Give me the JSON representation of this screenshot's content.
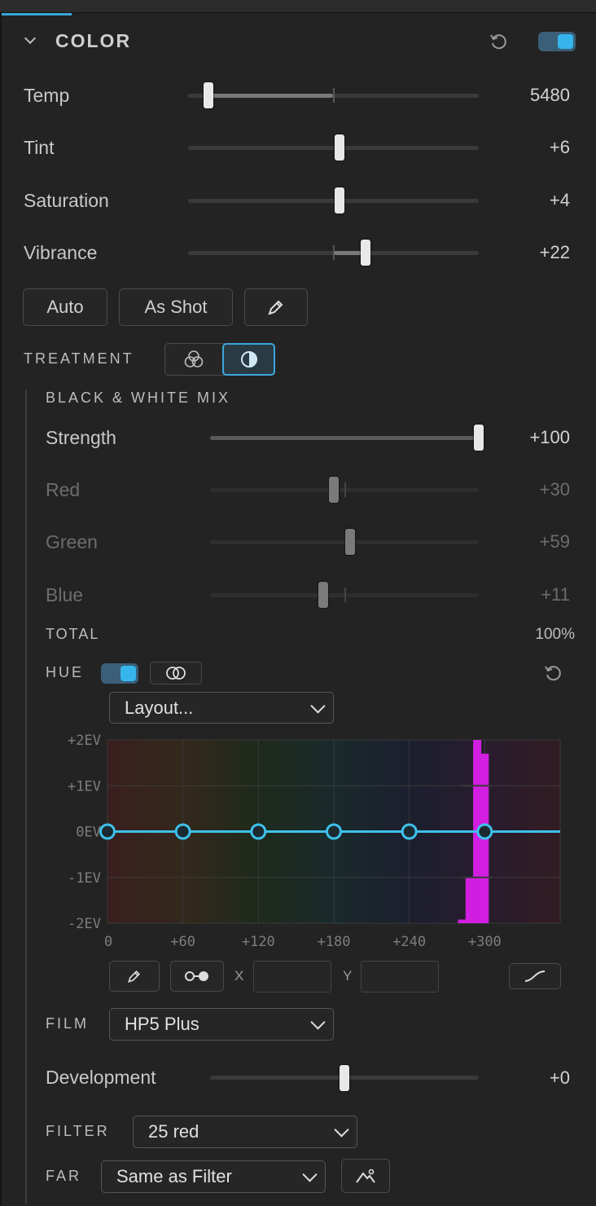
{
  "color_section": {
    "title": "COLOR",
    "sliders": [
      {
        "label": "Temp",
        "value": "5480",
        "position": 0.07
      },
      {
        "label": "Tint",
        "value": "+6",
        "position": 0.52
      },
      {
        "label": "Saturation",
        "value": "+4",
        "position": 0.52
      },
      {
        "label": "Vibrance",
        "value": "+22",
        "position": 0.61
      }
    ],
    "buttons": {
      "auto": "Auto",
      "as_shot": "As Shot"
    },
    "enabled": true
  },
  "treatment": {
    "label": "TREATMENT",
    "selected": "black-and-white"
  },
  "bw_mix": {
    "title": "BLACK & WHITE MIX",
    "sliders": [
      {
        "label": "Strength",
        "value": "+100",
        "position": 1.0
      },
      {
        "label": "Red",
        "value": "+30",
        "position": 0.46
      },
      {
        "label": "Green",
        "value": "+59",
        "position": 0.52
      },
      {
        "label": "Blue",
        "value": "+11",
        "position": 0.42
      }
    ],
    "total_label": "TOTAL",
    "total_value": "100%"
  },
  "hue": {
    "label": "HUE",
    "enabled": true,
    "layout_select": "Layout...",
    "chart_y_labels": [
      "+2EV",
      "+1EV",
      "0EV",
      "-1EV",
      "-2EV"
    ],
    "chart_x_labels": [
      "0",
      "+60",
      "+120",
      "+180",
      "+240",
      "+300"
    ],
    "x_label": "X",
    "y_label": "Y"
  },
  "chart_data": {
    "type": "line",
    "xlim": [
      0,
      360
    ],
    "ylim": [
      -2,
      2
    ],
    "points": [
      [
        0,
        0
      ],
      [
        60,
        0
      ],
      [
        120,
        0
      ],
      [
        180,
        0
      ],
      [
        240,
        0
      ],
      [
        300,
        0
      ]
    ],
    "histogram": [
      [
        282,
        0.08
      ],
      [
        288,
        1.0
      ],
      [
        294,
        4.0
      ],
      [
        300,
        3.7
      ]
    ],
    "grid": true,
    "colors": {
      "curve": "#3ec1ea",
      "histogram": "#d11ee0"
    }
  },
  "film": {
    "label": "FILM",
    "value": "HP5 Plus",
    "development_label": "Development",
    "development_value": "+0",
    "development_position": 0.5
  },
  "filter": {
    "label": "FILTER",
    "value": "25 red"
  },
  "far": {
    "label": "FAR",
    "value": "Same as Filter"
  }
}
